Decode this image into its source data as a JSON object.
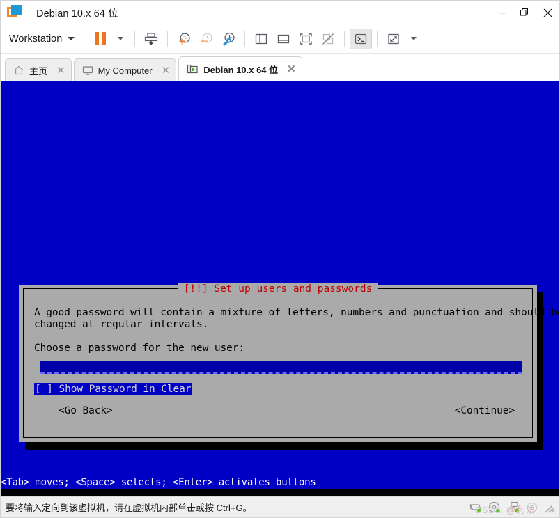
{
  "window": {
    "title": "Debian 10.x 64 位",
    "logo_icon": "vmware-logo-icon",
    "controls": {
      "minimize": "minimize-icon",
      "restore": "restore-icon",
      "close": "close-icon"
    }
  },
  "toolbar": {
    "menu_label": "Workstation",
    "menu_caret": "chevron-down-icon",
    "buttons": [
      {
        "name": "pause-button",
        "icon": "pause-icon",
        "title": "Pause"
      },
      {
        "name": "pause-dropdown",
        "icon": "chevron-down-icon",
        "title": "Power options"
      },
      {
        "name": "send-ctrl-alt-del-button",
        "icon": "send-key-icon",
        "title": "Send Ctrl+Alt+Del"
      },
      {
        "name": "take-snapshot-button",
        "icon": "snapshot-add-icon",
        "title": "Take a snapshot"
      },
      {
        "name": "revert-snapshot-button",
        "icon": "snapshot-revert-icon",
        "title": "Revert to snapshot"
      },
      {
        "name": "snapshot-manager-button",
        "icon": "snapshot-manager-icon",
        "title": "Manage snapshots"
      },
      {
        "name": "show-library-button",
        "icon": "panel-left-icon",
        "title": "Show or hide the library"
      },
      {
        "name": "show-thumbnails-button",
        "icon": "panel-bottom-icon",
        "title": "Show or hide thumbnails"
      },
      {
        "name": "fullscreen-button",
        "icon": "fullscreen-icon",
        "title": "Enter full screen mode"
      },
      {
        "name": "unity-mode-button",
        "icon": "unity-off-icon",
        "title": "Unity mode"
      },
      {
        "name": "console-view-button",
        "icon": "console-icon",
        "title": "Console view",
        "active": true
      },
      {
        "name": "stretch-guest-button",
        "icon": "expand-arrows-icon",
        "title": "Stretch guest"
      },
      {
        "name": "stretch-dropdown",
        "icon": "chevron-down-icon",
        "title": "Display options"
      }
    ]
  },
  "tabs": [
    {
      "name": "tab-home",
      "label": "主页",
      "icon": "home-icon",
      "active": false,
      "close_icon": "close-icon"
    },
    {
      "name": "tab-my-computer",
      "label": "My Computer",
      "icon": "monitor-icon",
      "active": false,
      "close_icon": "close-icon"
    },
    {
      "name": "tab-debian-vm",
      "label": "Debian 10.x 64 位",
      "icon": "vm-running-icon",
      "active": true,
      "close_icon": "close-icon"
    }
  ],
  "installer": {
    "title": "[!!] Set up users and passwords",
    "paragraph_line1": "A good password will contain a mixture of letters, numbers and punctuation and should be",
    "paragraph_line2": "changed at regular intervals.",
    "prompt": "Choose a password for the new user:",
    "password_value": "",
    "show_password_checkbox": "[ ] Show Password in Clear",
    "go_back_button": "<Go Back>",
    "continue_button": "<Continue>",
    "help_line": "<Tab> moves; <Space> selects; <Enter> activates buttons",
    "colors": {
      "screen_background": "#0000c4",
      "dialog_background": "#aaaaaa",
      "title_text": "#c00000",
      "field_background": "#0000a8",
      "highlight_background": "#0000c4"
    }
  },
  "statusbar": {
    "message": "要将输入定向到该虚拟机，请在虚拟机内部单击或按 Ctrl+G。",
    "devices": [
      {
        "name": "hard-disk-status-icon",
        "icon": "hard-disk-icon"
      },
      {
        "name": "cd-dvd-status-icon",
        "icon": "disc-icon"
      },
      {
        "name": "network-status-icon",
        "icon": "network-icon"
      },
      {
        "name": "sound-status-icon",
        "icon": "speaker-icon"
      }
    ],
    "watermark_primary": "CSDN",
    "watermark_secondary": "@利法"
  }
}
